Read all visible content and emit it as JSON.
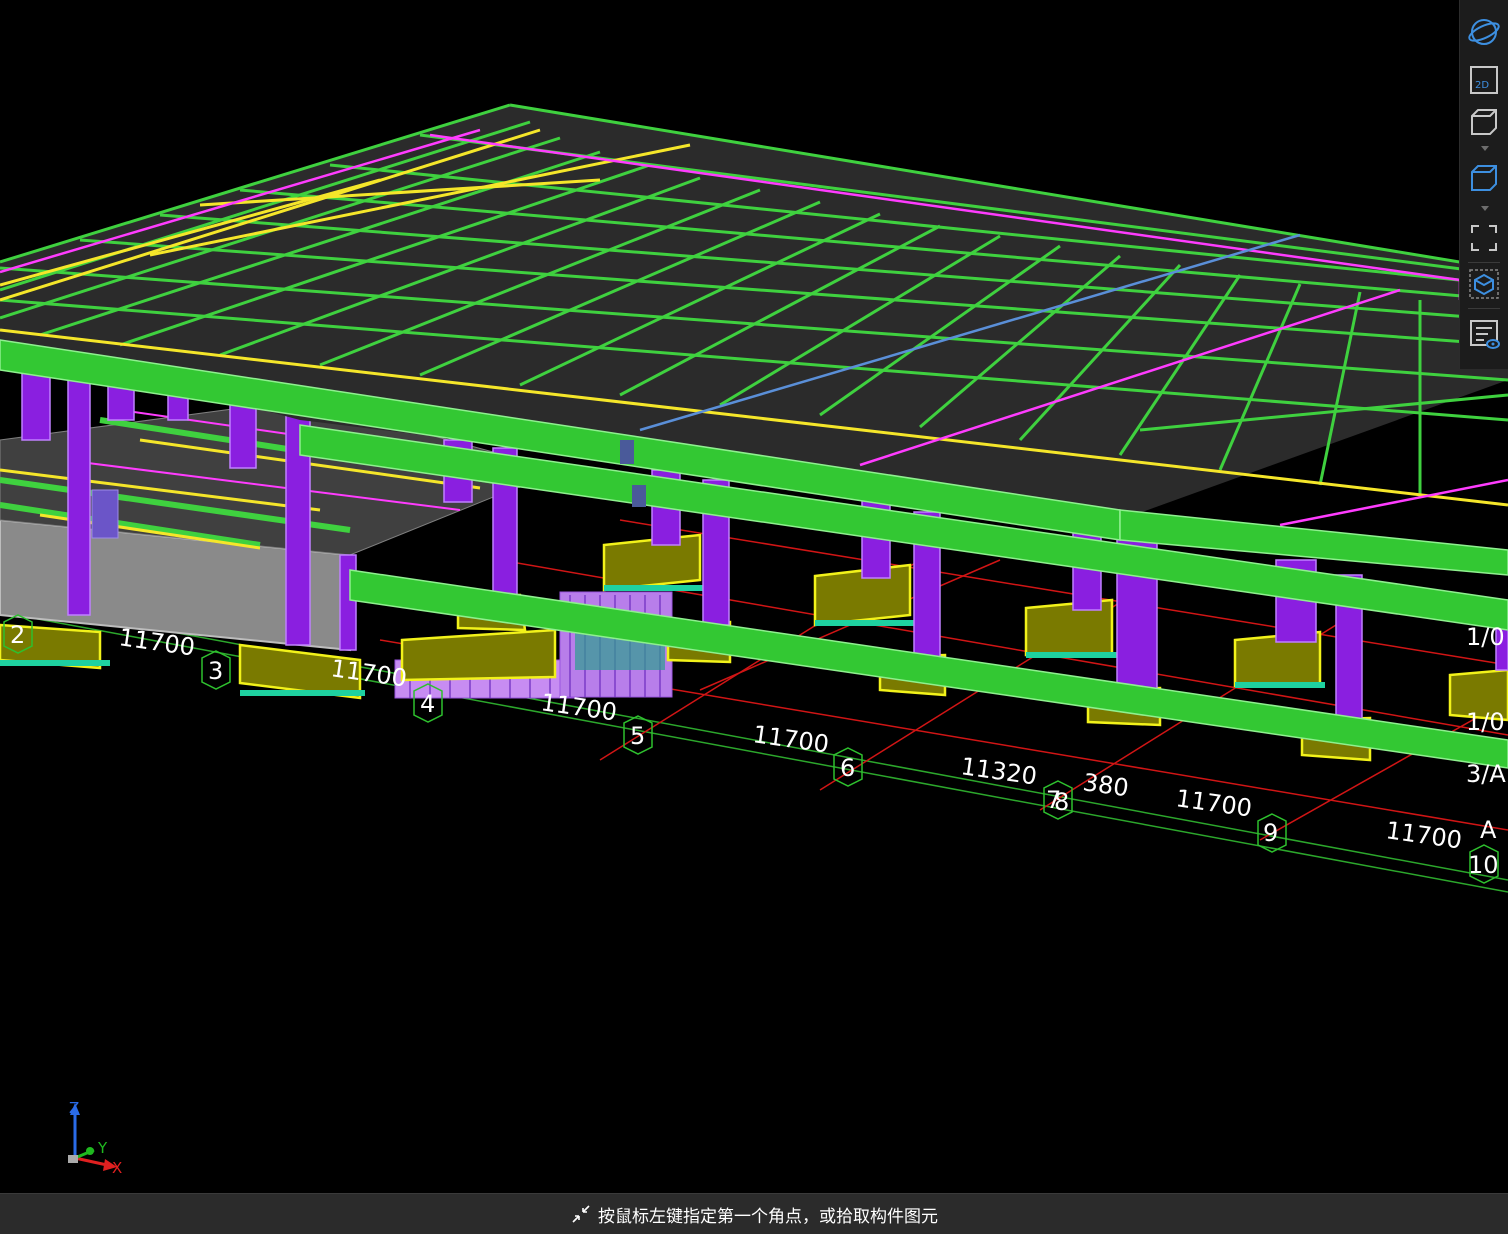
{
  "viewport": {
    "grid_dimensions": [
      "11700",
      "11700",
      "11700",
      "11700",
      "11320",
      "380",
      "11700",
      "11700"
    ],
    "grid_axes": [
      "2",
      "3",
      "4",
      "5",
      "6",
      "7",
      "8",
      "9",
      "10"
    ],
    "row_axes": [
      "A",
      "3/A",
      "1/0",
      "1/0"
    ]
  },
  "toolbar": {
    "buttons": [
      {
        "icon": "orbit-icon"
      },
      {
        "icon": "2d-view-icon",
        "label": "2D"
      },
      {
        "icon": "3d-box-icon"
      },
      {
        "icon": "3d-box-blue-icon"
      },
      {
        "icon": "fullscreen-icon"
      },
      {
        "icon": "component-view-icon"
      },
      {
        "icon": "layer-display-icon"
      }
    ]
  },
  "triad": {
    "x": "X",
    "y": "Y",
    "z": "Z"
  },
  "statusbar": {
    "hint": "按鼠标左键指定第一个角点，或拾取构件图元"
  },
  "colors": {
    "beam": "#3fd13f",
    "column": "#8a1fe0",
    "footing": "#7a7a00",
    "rebar_yellow": "#f5e62a",
    "rebar_magenta": "#ff3cff",
    "grid_red": "#e01616"
  }
}
